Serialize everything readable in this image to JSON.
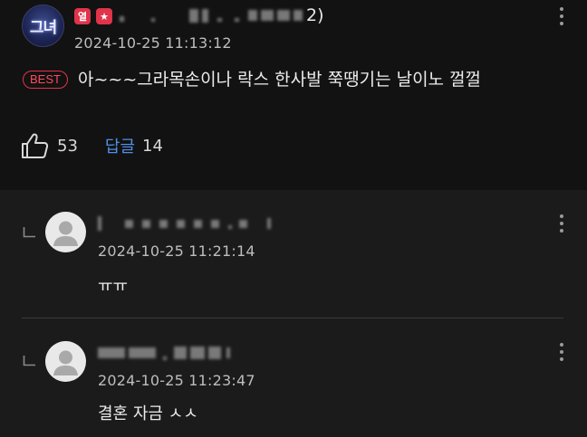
{
  "comment": {
    "avatar_text": "그녀",
    "badges": [
      "열",
      "★"
    ],
    "username_suffix": "2)",
    "timestamp": "2024-10-25 11:13:12",
    "best_label": "BEST",
    "body": "아~~~그라목손이나 락스 한사발 쭉땡기는 날이노 껄껄",
    "like_count": "53",
    "reply_label": "답글",
    "reply_count": "14"
  },
  "replies": [
    {
      "timestamp": "2024-10-25 11:21:14",
      "text": "ㅠㅠ"
    },
    {
      "timestamp": "2024-10-25 11:23:47",
      "text": "결혼 자금 ㅅㅅ"
    }
  ],
  "icons": {
    "like": "thumbs-up-icon",
    "more": "kebab-menu-icon",
    "reply_indicator": "reply-arrow-icon",
    "avatar_default": "person-icon"
  },
  "colors": {
    "background": "#121212",
    "reply_background": "#1b1b1b",
    "best_red": "#e0344a",
    "reply_link_blue": "#4f8fe6"
  }
}
